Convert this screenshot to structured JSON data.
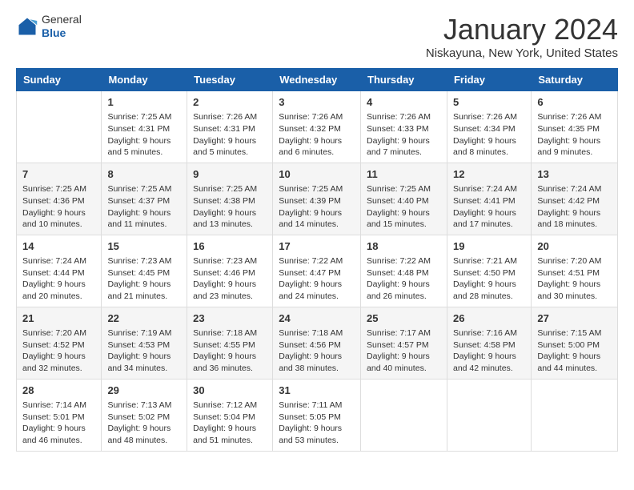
{
  "header": {
    "logo_general": "General",
    "logo_blue": "Blue",
    "month_title": "January 2024",
    "location": "Niskayuna, New York, United States"
  },
  "weekdays": [
    "Sunday",
    "Monday",
    "Tuesday",
    "Wednesday",
    "Thursday",
    "Friday",
    "Saturday"
  ],
  "weeks": [
    [
      {
        "day": "",
        "sunrise": "",
        "sunset": "",
        "daylight": ""
      },
      {
        "day": "1",
        "sunrise": "Sunrise: 7:25 AM",
        "sunset": "Sunset: 4:31 PM",
        "daylight": "Daylight: 9 hours and 5 minutes."
      },
      {
        "day": "2",
        "sunrise": "Sunrise: 7:26 AM",
        "sunset": "Sunset: 4:31 PM",
        "daylight": "Daylight: 9 hours and 5 minutes."
      },
      {
        "day": "3",
        "sunrise": "Sunrise: 7:26 AM",
        "sunset": "Sunset: 4:32 PM",
        "daylight": "Daylight: 9 hours and 6 minutes."
      },
      {
        "day": "4",
        "sunrise": "Sunrise: 7:26 AM",
        "sunset": "Sunset: 4:33 PM",
        "daylight": "Daylight: 9 hours and 7 minutes."
      },
      {
        "day": "5",
        "sunrise": "Sunrise: 7:26 AM",
        "sunset": "Sunset: 4:34 PM",
        "daylight": "Daylight: 9 hours and 8 minutes."
      },
      {
        "day": "6",
        "sunrise": "Sunrise: 7:26 AM",
        "sunset": "Sunset: 4:35 PM",
        "daylight": "Daylight: 9 hours and 9 minutes."
      }
    ],
    [
      {
        "day": "7",
        "sunrise": "Sunrise: 7:25 AM",
        "sunset": "Sunset: 4:36 PM",
        "daylight": "Daylight: 9 hours and 10 minutes."
      },
      {
        "day": "8",
        "sunrise": "Sunrise: 7:25 AM",
        "sunset": "Sunset: 4:37 PM",
        "daylight": "Daylight: 9 hours and 11 minutes."
      },
      {
        "day": "9",
        "sunrise": "Sunrise: 7:25 AM",
        "sunset": "Sunset: 4:38 PM",
        "daylight": "Daylight: 9 hours and 13 minutes."
      },
      {
        "day": "10",
        "sunrise": "Sunrise: 7:25 AM",
        "sunset": "Sunset: 4:39 PM",
        "daylight": "Daylight: 9 hours and 14 minutes."
      },
      {
        "day": "11",
        "sunrise": "Sunrise: 7:25 AM",
        "sunset": "Sunset: 4:40 PM",
        "daylight": "Daylight: 9 hours and 15 minutes."
      },
      {
        "day": "12",
        "sunrise": "Sunrise: 7:24 AM",
        "sunset": "Sunset: 4:41 PM",
        "daylight": "Daylight: 9 hours and 17 minutes."
      },
      {
        "day": "13",
        "sunrise": "Sunrise: 7:24 AM",
        "sunset": "Sunset: 4:42 PM",
        "daylight": "Daylight: 9 hours and 18 minutes."
      }
    ],
    [
      {
        "day": "14",
        "sunrise": "Sunrise: 7:24 AM",
        "sunset": "Sunset: 4:44 PM",
        "daylight": "Daylight: 9 hours and 20 minutes."
      },
      {
        "day": "15",
        "sunrise": "Sunrise: 7:23 AM",
        "sunset": "Sunset: 4:45 PM",
        "daylight": "Daylight: 9 hours and 21 minutes."
      },
      {
        "day": "16",
        "sunrise": "Sunrise: 7:23 AM",
        "sunset": "Sunset: 4:46 PM",
        "daylight": "Daylight: 9 hours and 23 minutes."
      },
      {
        "day": "17",
        "sunrise": "Sunrise: 7:22 AM",
        "sunset": "Sunset: 4:47 PM",
        "daylight": "Daylight: 9 hours and 24 minutes."
      },
      {
        "day": "18",
        "sunrise": "Sunrise: 7:22 AM",
        "sunset": "Sunset: 4:48 PM",
        "daylight": "Daylight: 9 hours and 26 minutes."
      },
      {
        "day": "19",
        "sunrise": "Sunrise: 7:21 AM",
        "sunset": "Sunset: 4:50 PM",
        "daylight": "Daylight: 9 hours and 28 minutes."
      },
      {
        "day": "20",
        "sunrise": "Sunrise: 7:20 AM",
        "sunset": "Sunset: 4:51 PM",
        "daylight": "Daylight: 9 hours and 30 minutes."
      }
    ],
    [
      {
        "day": "21",
        "sunrise": "Sunrise: 7:20 AM",
        "sunset": "Sunset: 4:52 PM",
        "daylight": "Daylight: 9 hours and 32 minutes."
      },
      {
        "day": "22",
        "sunrise": "Sunrise: 7:19 AM",
        "sunset": "Sunset: 4:53 PM",
        "daylight": "Daylight: 9 hours and 34 minutes."
      },
      {
        "day": "23",
        "sunrise": "Sunrise: 7:18 AM",
        "sunset": "Sunset: 4:55 PM",
        "daylight": "Daylight: 9 hours and 36 minutes."
      },
      {
        "day": "24",
        "sunrise": "Sunrise: 7:18 AM",
        "sunset": "Sunset: 4:56 PM",
        "daylight": "Daylight: 9 hours and 38 minutes."
      },
      {
        "day": "25",
        "sunrise": "Sunrise: 7:17 AM",
        "sunset": "Sunset: 4:57 PM",
        "daylight": "Daylight: 9 hours and 40 minutes."
      },
      {
        "day": "26",
        "sunrise": "Sunrise: 7:16 AM",
        "sunset": "Sunset: 4:58 PM",
        "daylight": "Daylight: 9 hours and 42 minutes."
      },
      {
        "day": "27",
        "sunrise": "Sunrise: 7:15 AM",
        "sunset": "Sunset: 5:00 PM",
        "daylight": "Daylight: 9 hours and 44 minutes."
      }
    ],
    [
      {
        "day": "28",
        "sunrise": "Sunrise: 7:14 AM",
        "sunset": "Sunset: 5:01 PM",
        "daylight": "Daylight: 9 hours and 46 minutes."
      },
      {
        "day": "29",
        "sunrise": "Sunrise: 7:13 AM",
        "sunset": "Sunset: 5:02 PM",
        "daylight": "Daylight: 9 hours and 48 minutes."
      },
      {
        "day": "30",
        "sunrise": "Sunrise: 7:12 AM",
        "sunset": "Sunset: 5:04 PM",
        "daylight": "Daylight: 9 hours and 51 minutes."
      },
      {
        "day": "31",
        "sunrise": "Sunrise: 7:11 AM",
        "sunset": "Sunset: 5:05 PM",
        "daylight": "Daylight: 9 hours and 53 minutes."
      },
      {
        "day": "",
        "sunrise": "",
        "sunset": "",
        "daylight": ""
      },
      {
        "day": "",
        "sunrise": "",
        "sunset": "",
        "daylight": ""
      },
      {
        "day": "",
        "sunrise": "",
        "sunset": "",
        "daylight": ""
      }
    ]
  ]
}
